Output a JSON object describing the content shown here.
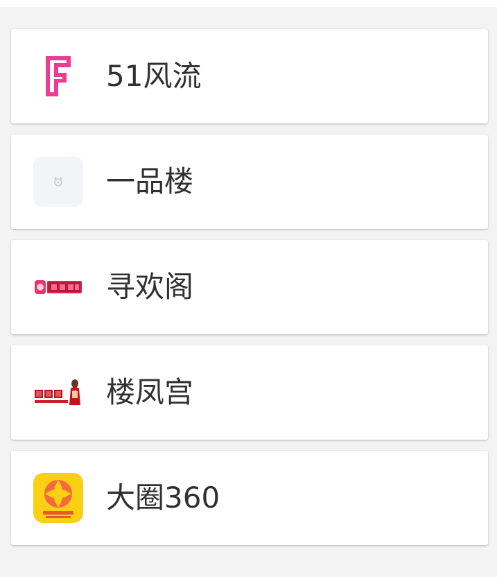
{
  "apps": [
    {
      "name": "51风流",
      "icon": "pink-f-logo-icon"
    },
    {
      "name": "一品楼",
      "icon": "placeholder-image-icon"
    },
    {
      "name": "寻欢阁",
      "icon": "xunhuange-logo-icon"
    },
    {
      "name": "楼凤宫",
      "icon": "loufenggong-logo-icon"
    },
    {
      "name": "大圈360",
      "icon": "daquan360-logo-icon"
    }
  ],
  "colors": {
    "background": "#f3f3f3",
    "card": "#ffffff",
    "text": "#303030",
    "accent_pink": "#ee3b8f",
    "accent_yellow": "#fbcf14"
  }
}
